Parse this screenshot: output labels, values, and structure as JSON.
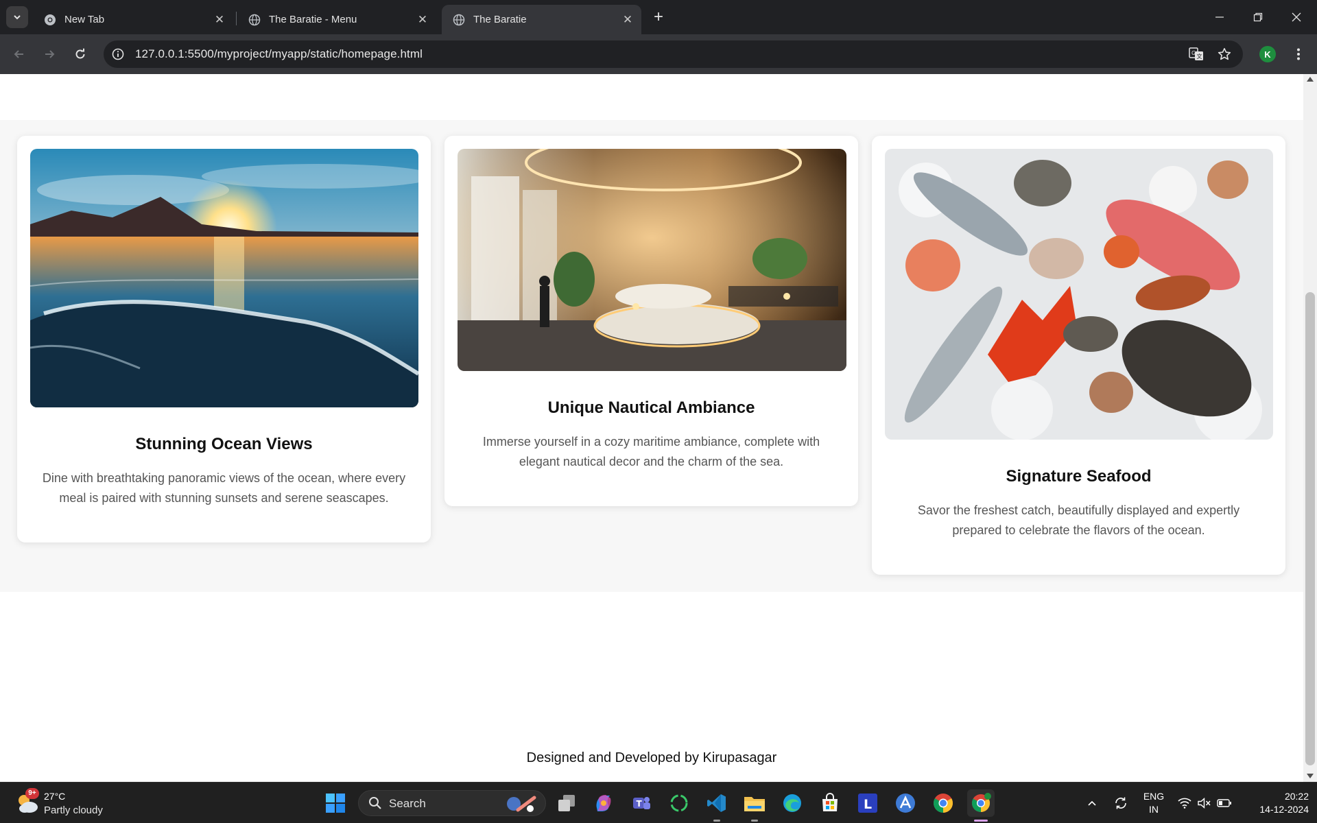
{
  "browser": {
    "tabs": [
      {
        "title": "New Tab",
        "active": false
      },
      {
        "title": "The Baratie - Menu",
        "active": false
      },
      {
        "title": "The Baratie",
        "active": true
      }
    ],
    "url": "127.0.0.1:5500/myproject/myapp/static/homepage.html",
    "profile_initial": "K"
  },
  "page": {
    "features": [
      {
        "title": "Stunning Ocean Views",
        "description": "Dine with breathtaking panoramic views of the ocean, where every meal is paired with stunning sunsets and serene seascapes."
      },
      {
        "title": "Unique Nautical Ambiance",
        "description": "Immerse yourself in a cozy maritime ambiance, complete with elegant nautical decor and the charm of the sea."
      },
      {
        "title": "Signature Seafood",
        "description": "Savor the freshest catch, beautifully displayed and expertly prepared to celebrate the flavors of the ocean."
      }
    ],
    "footer": "Designed and Developed by Kirupasagar"
  },
  "taskbar": {
    "weather_badge": "9+",
    "temperature": "27°C",
    "condition": "Partly cloudy",
    "search_label": "Search",
    "language_line1": "ENG",
    "language_line2": "IN",
    "time": "20:22",
    "date": "14-12-2024"
  },
  "colors": {
    "browser_frame": "#202124",
    "toolbar": "#35363a",
    "page_section_bg": "#f7f7f7",
    "taskbar": "#202020"
  }
}
